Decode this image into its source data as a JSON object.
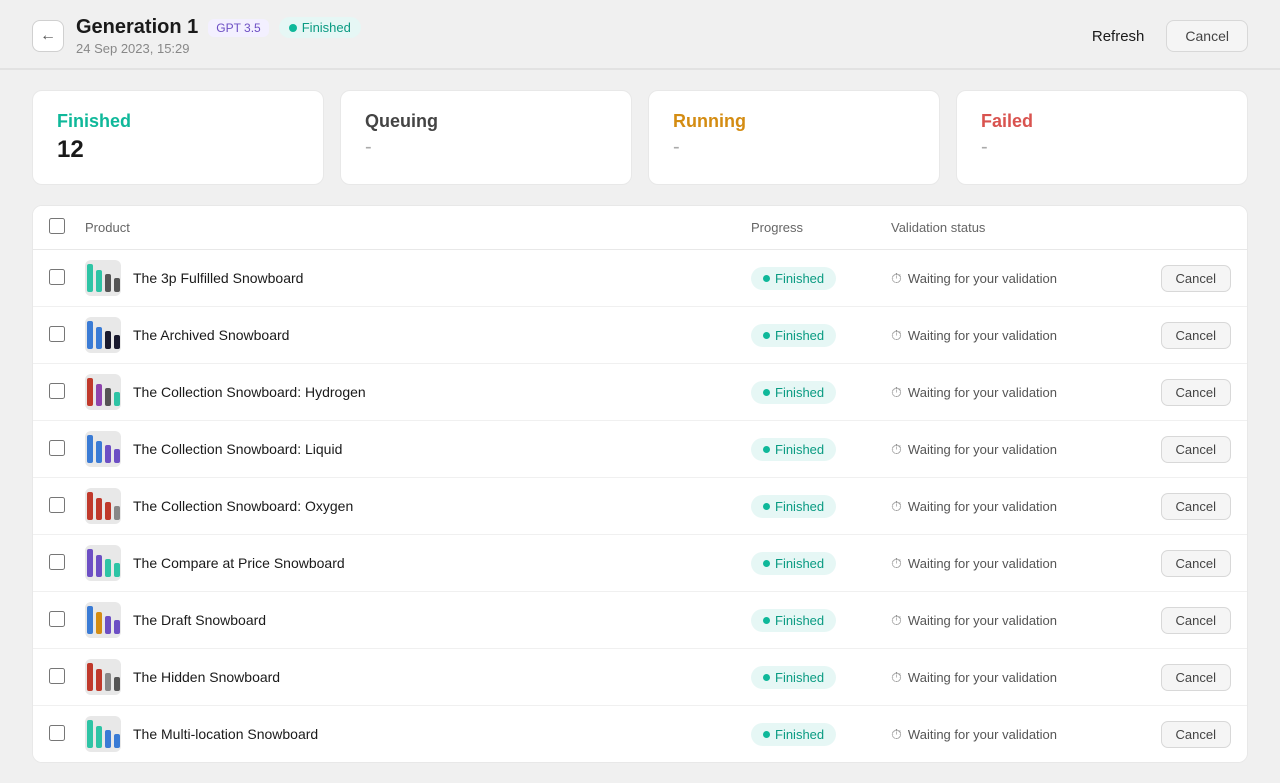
{
  "header": {
    "back_label": "←",
    "title": "Generation 1",
    "badge_gpt": "GPT 3.5",
    "badge_status": "Finished",
    "date": "24 Sep 2023, 15:29",
    "refresh_label": "Refresh",
    "cancel_label": "Cancel"
  },
  "stats": {
    "finished": {
      "label": "Finished",
      "value": "12"
    },
    "queuing": {
      "label": "Queuing",
      "value": "-"
    },
    "running": {
      "label": "Running",
      "value": "-"
    },
    "failed": {
      "label": "Failed",
      "value": "-"
    }
  },
  "table": {
    "col_product": "Product",
    "col_progress": "Progress",
    "col_validation": "Validation status",
    "cancel_label": "Cancel",
    "rows": [
      {
        "name": "The 3p Fulfilled Snowboard",
        "progress": "Finished",
        "validation": "Waiting for your validation",
        "colors": [
          "#2ec4a5",
          "#2ec4a5",
          "#555",
          "#555"
        ]
      },
      {
        "name": "The Archived Snowboard",
        "progress": "Finished",
        "validation": "Waiting for your validation",
        "colors": [
          "#3a7bd5",
          "#3a7bd5",
          "#1a1a2e",
          "#1a1a2e"
        ]
      },
      {
        "name": "The Collection Snowboard: Hydrogen",
        "progress": "Finished",
        "validation": "Waiting for your validation",
        "colors": [
          "#c0392b",
          "#8e44ad",
          "#555",
          "#2ec4a5"
        ]
      },
      {
        "name": "The Collection Snowboard: Liquid",
        "progress": "Finished",
        "validation": "Waiting for your validation",
        "colors": [
          "#3a7bd5",
          "#3a7bd5",
          "#6d4fc4",
          "#6d4fc4"
        ]
      },
      {
        "name": "The Collection Snowboard: Oxygen",
        "progress": "Finished",
        "validation": "Waiting for your validation",
        "colors": [
          "#c0392b",
          "#c0392b",
          "#c0392b",
          "#888"
        ]
      },
      {
        "name": "The Compare at Price Snowboard",
        "progress": "Finished",
        "validation": "Waiting for your validation",
        "colors": [
          "#6d4fc4",
          "#6d4fc4",
          "#2ec4a5",
          "#2ec4a5"
        ]
      },
      {
        "name": "The Draft Snowboard",
        "progress": "Finished",
        "validation": "Waiting for your validation",
        "colors": [
          "#3a7bd5",
          "#d48c12",
          "#6d4fc4",
          "#6d4fc4"
        ]
      },
      {
        "name": "The Hidden Snowboard",
        "progress": "Finished",
        "validation": "Waiting for your validation",
        "colors": [
          "#c0392b",
          "#c0392b",
          "#888",
          "#555"
        ]
      },
      {
        "name": "The Multi-location Snowboard",
        "progress": "Finished",
        "validation": "Waiting for your validation",
        "colors": [
          "#2ec4a5",
          "#2ec4a5",
          "#3a7bd5",
          "#3a7bd5"
        ]
      }
    ]
  }
}
